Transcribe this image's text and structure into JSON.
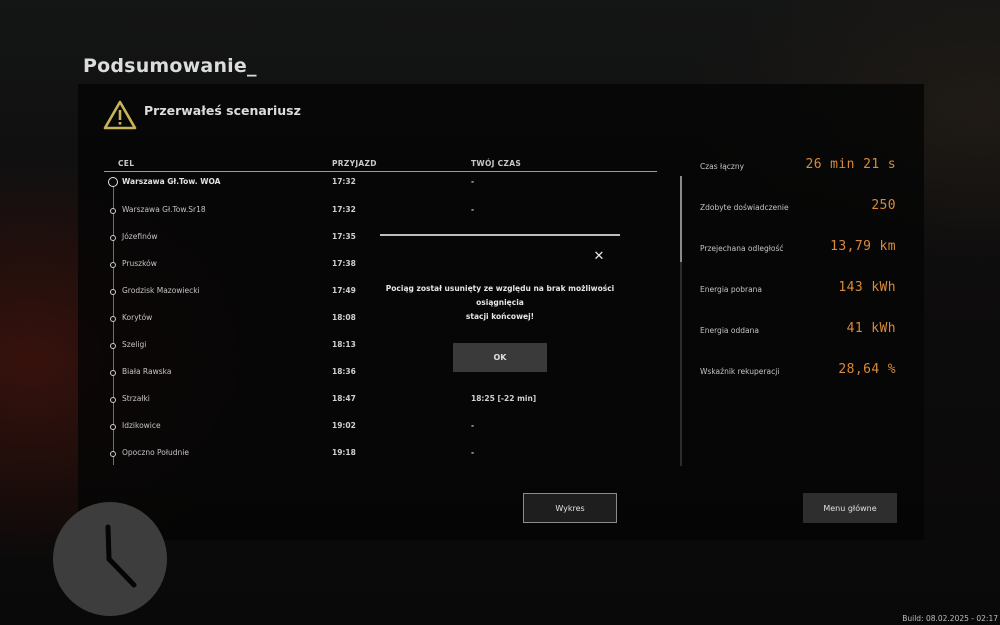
{
  "page_title": "Podsumowanie_",
  "scenario_message": "Przerwałeś scenariusz",
  "columns": {
    "destination": "CEL",
    "arrival": "PRZYJAZD",
    "your_time": "TWÓJ CZAS"
  },
  "stops": [
    {
      "station": "Warszawa Gł.Tow. WOA",
      "arrival": "17:32",
      "your_time": "-"
    },
    {
      "station": "Warszawa Gł.Tow.Sr18",
      "arrival": "17:32",
      "your_time": "-"
    },
    {
      "station": "Józefinów",
      "arrival": "17:35",
      "your_time": ""
    },
    {
      "station": "Pruszków",
      "arrival": "17:38",
      "your_time": ""
    },
    {
      "station": "Grodzisk Mazowiecki",
      "arrival": "17:49",
      "your_time": ""
    },
    {
      "station": "Korytów",
      "arrival": "18:08",
      "your_time": ""
    },
    {
      "station": "Szeligi",
      "arrival": "18:13",
      "your_time": ""
    },
    {
      "station": "Biała Rawska",
      "arrival": "18:36",
      "your_time": ""
    },
    {
      "station": "Strzałki",
      "arrival": "18:47",
      "your_time": "18:25 [-22 min]"
    },
    {
      "station": "Idzikowice",
      "arrival": "19:02",
      "your_time": "-"
    },
    {
      "station": "Opoczno Południe",
      "arrival": "19:18",
      "your_time": "-"
    }
  ],
  "stats": [
    {
      "label": "Czas łączny",
      "value": "26 min 21 s"
    },
    {
      "label": "Zdobyte doświadczenie",
      "value": "250"
    },
    {
      "label": "Przejechana odległość",
      "value": "13,79 km"
    },
    {
      "label": "Energia pobrana",
      "value": "143 kWh"
    },
    {
      "label": "Energia oddana",
      "value": "41 kWh"
    },
    {
      "label": "Wskaźnik rekuperacji",
      "value": "28,64 %"
    }
  ],
  "dialog": {
    "message_line1": "Pociąg został usunięty ze względu na brak możliwości osiągnięcia",
    "message_line2": "stacji końcowej!",
    "close_glyph": "✕",
    "ok_label": "OK"
  },
  "buttons": {
    "chart_label": "Wykres",
    "main_menu_label": "Menu główne"
  },
  "build_info": "Build: 08.02.2025 - 02:17",
  "colors": {
    "accent_orange": "#d98a3a",
    "warning_icon": "#c9b35a"
  },
  "icons": {
    "warning": "warning-triangle-icon",
    "clock": "clock-icon",
    "close": "close-icon"
  }
}
